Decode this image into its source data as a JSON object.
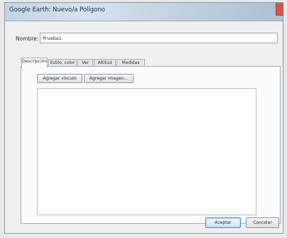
{
  "window": {
    "title": "Google Earth: Nuevo/a Polígono"
  },
  "name_field": {
    "label": "Nombre:",
    "value": "Prueba1"
  },
  "tabs": [
    {
      "label": "Descripción",
      "active": true
    },
    {
      "label": "Estilo, color",
      "active": false
    },
    {
      "label": "Ver",
      "active": false
    },
    {
      "label": "Altitud",
      "active": false
    },
    {
      "label": "Medidas",
      "active": false
    }
  ],
  "description_panel": {
    "add_link_label": "Agregar vínculo",
    "add_image_label": "Agregar imagen...",
    "text_value": ""
  },
  "footer": {
    "ok_label": "Aceptar",
    "cancel_label": "Cancelar"
  }
}
